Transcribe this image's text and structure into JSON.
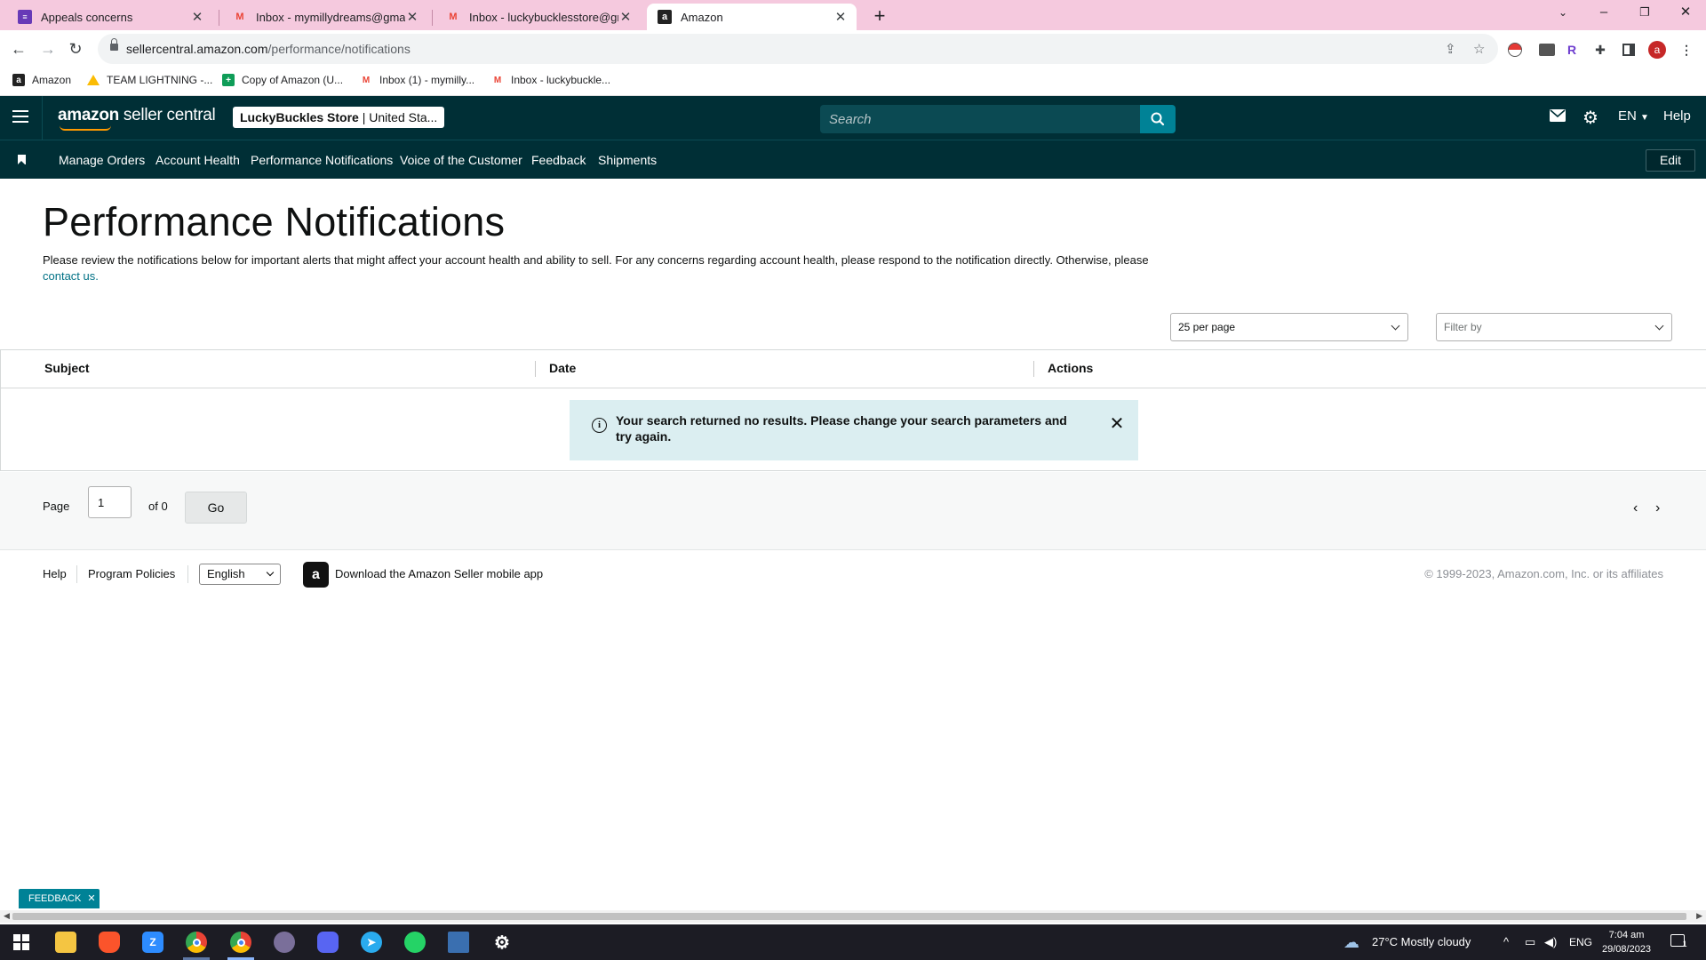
{
  "browser": {
    "tabs": [
      {
        "title": "Appeals concerns",
        "icon": "forms-icon",
        "active": false
      },
      {
        "title": "Inbox - mymillydreams@gmail.com",
        "icon": "gmail-icon",
        "active": false
      },
      {
        "title": "Inbox - luckybucklesstore@gmail.com",
        "icon": "gmail-icon",
        "active": false
      },
      {
        "title": "Amazon",
        "icon": "amazon-icon",
        "active": true
      }
    ],
    "new_tab": "+",
    "url_host": "sellercentral.amazon.com",
    "url_path": "/performance/notifications",
    "profile_initial": "a",
    "bookmarks": [
      {
        "label": "Amazon",
        "icon": "amazon-icon"
      },
      {
        "label": "TEAM LIGHTNING -...",
        "icon": "drive-icon"
      },
      {
        "label": "Copy of Amazon (U...",
        "icon": "sheets-icon"
      },
      {
        "label": "Inbox (1) - mymilly...",
        "icon": "gmail-icon"
      },
      {
        "label": "Inbox - luckybuckle...",
        "icon": "gmail-icon"
      }
    ]
  },
  "header": {
    "logo_bold": "amazon",
    "logo_rest": " seller central",
    "store_name": "LuckyBuckles Store",
    "store_region": " | United Sta...",
    "search_placeholder": "Search",
    "language": "EN",
    "help": "Help"
  },
  "nav": {
    "items": [
      "Manage Orders",
      "Account Health",
      "Performance Notifications",
      "Voice of the Customer",
      "Feedback",
      "Shipments"
    ],
    "edit": "Edit"
  },
  "main": {
    "title": "Performance Notifications",
    "intro": "Please review the notifications below for important alerts that might affect your account health and ability to sell. For any concerns regarding account health, please respond to the notification directly. Otherwise, please ",
    "intro_link": "contact us.",
    "per_page": "25 per page",
    "filter_placeholder": "Filter by",
    "columns": [
      "Subject",
      "Date",
      "Actions"
    ],
    "alert": "Your search returned no results. Please change your search parameters and try again.",
    "pager": {
      "label": "Page",
      "value": "1",
      "of": "of 0",
      "go": "Go"
    }
  },
  "footer": {
    "help": "Help",
    "policies": "Program Policies",
    "language": "English",
    "app": "Download the Amazon Seller mobile app",
    "copyright": "© 1999-2023, Amazon.com, Inc. or its affiliates"
  },
  "feedback_tab": "FEEDBACK",
  "taskbar": {
    "weather": "27°C  Mostly cloudy",
    "lang": "ENG",
    "time": "7:04 am",
    "date": "29/08/2023",
    "notifications": "1"
  },
  "colors": {
    "header_bg": "#002f36",
    "accent_teal": "#008296",
    "alert_bg": "#dbeef1",
    "link": "#007185",
    "tab_strip": "#f5c9de"
  }
}
